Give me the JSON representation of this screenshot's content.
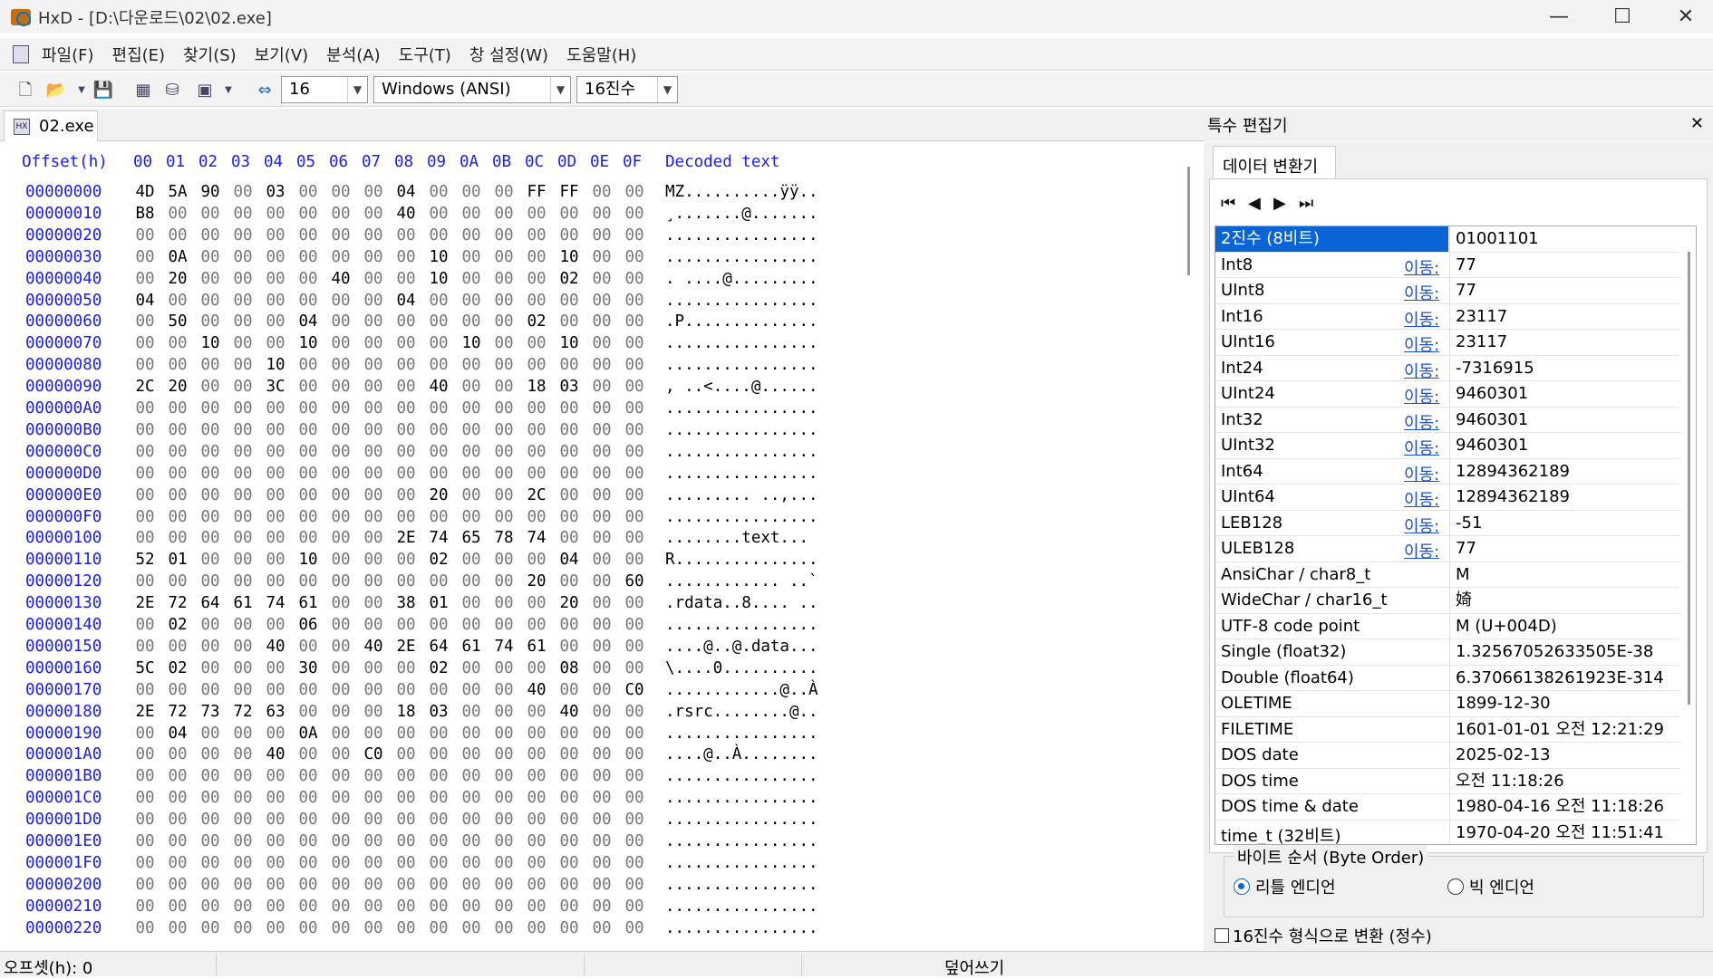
{
  "window": {
    "title": "HxD - [D:\\다운로드\\02\\02.exe]",
    "minimize": "—",
    "maximize": "☐",
    "close": "✕"
  },
  "menu": [
    "파일(F)",
    "편집(E)",
    "찾기(S)",
    "보기(V)",
    "분석(A)",
    "도구(T)",
    "창 설정(W)",
    "도움말(H)"
  ],
  "toolbar": {
    "bytes_per_row": "16",
    "charset": "Windows (ANSI)",
    "offset_base": "16진수"
  },
  "tab": {
    "label": "02.exe"
  },
  "hex": {
    "header_offset": "Offset(h)",
    "header_cols": [
      "00",
      "01",
      "02",
      "03",
      "04",
      "05",
      "06",
      "07",
      "08",
      "09",
      "0A",
      "0B",
      "0C",
      "0D",
      "0E",
      "0F"
    ],
    "header_decoded": "Decoded text",
    "rows": [
      {
        "off": "00000000",
        "bytes": "4D 5A 90 00 03 00 00 00 04 00 00 00 FF FF 00 00",
        "text": "MZ..........ÿÿ.."
      },
      {
        "off": "00000010",
        "bytes": "B8 00 00 00 00 00 00 00 40 00 00 00 00 00 00 00",
        "text": "¸.......@......."
      },
      {
        "off": "00000020",
        "bytes": "00 00 00 00 00 00 00 00 00 00 00 00 00 00 00 00",
        "text": "................"
      },
      {
        "off": "00000030",
        "bytes": "00 0A 00 00 00 00 00 00 00 10 00 00 00 10 00 00",
        "text": "................"
      },
      {
        "off": "00000040",
        "bytes": "00 20 00 00 00 00 40 00 00 10 00 00 00 02 00 00",
        "text": ". ....@........."
      },
      {
        "off": "00000050",
        "bytes": "04 00 00 00 00 00 00 00 04 00 00 00 00 00 00 00",
        "text": "................"
      },
      {
        "off": "00000060",
        "bytes": "00 50 00 00 00 04 00 00 00 00 00 00 02 00 00 00",
        "text": ".P.............."
      },
      {
        "off": "00000070",
        "bytes": "00 00 10 00 00 10 00 00 00 00 10 00 00 10 00 00",
        "text": "................"
      },
      {
        "off": "00000080",
        "bytes": "00 00 00 00 10 00 00 00 00 00 00 00 00 00 00 00",
        "text": "................"
      },
      {
        "off": "00000090",
        "bytes": "2C 20 00 00 3C 00 00 00 00 40 00 00 18 03 00 00",
        "text": ", ..<....@......"
      },
      {
        "off": "000000A0",
        "bytes": "00 00 00 00 00 00 00 00 00 00 00 00 00 00 00 00",
        "text": "................"
      },
      {
        "off": "000000B0",
        "bytes": "00 00 00 00 00 00 00 00 00 00 00 00 00 00 00 00",
        "text": "................"
      },
      {
        "off": "000000C0",
        "bytes": "00 00 00 00 00 00 00 00 00 00 00 00 00 00 00 00",
        "text": "................"
      },
      {
        "off": "000000D0",
        "bytes": "00 00 00 00 00 00 00 00 00 00 00 00 00 00 00 00",
        "text": "................"
      },
      {
        "off": "000000E0",
        "bytes": "00 00 00 00 00 00 00 00 00 20 00 00 2C 00 00 00",
        "text": "......... ..,..."
      },
      {
        "off": "000000F0",
        "bytes": "00 00 00 00 00 00 00 00 00 00 00 00 00 00 00 00",
        "text": "................"
      },
      {
        "off": "00000100",
        "bytes": "00 00 00 00 00 00 00 00 2E 74 65 78 74 00 00 00",
        "text": "........text..."
      },
      {
        "off": "00000110",
        "bytes": "52 01 00 00 00 10 00 00 00 02 00 00 00 04 00 00",
        "text": "R..............."
      },
      {
        "off": "00000120",
        "bytes": "00 00 00 00 00 00 00 00 00 00 00 00 20 00 00 60",
        "text": "............ ..`"
      },
      {
        "off": "00000130",
        "bytes": "2E 72 64 61 74 61 00 00 38 01 00 00 00 20 00 00",
        "text": ".rdata..8.... .."
      },
      {
        "off": "00000140",
        "bytes": "00 02 00 00 00 06 00 00 00 00 00 00 00 00 00 00",
        "text": "................"
      },
      {
        "off": "00000150",
        "bytes": "00 00 00 00 40 00 00 40 2E 64 61 74 61 00 00 00",
        "text": "....@..@.data..."
      },
      {
        "off": "00000160",
        "bytes": "5C 02 00 00 00 30 00 00 00 02 00 00 00 08 00 00",
        "text": "\\....0.........."
      },
      {
        "off": "00000170",
        "bytes": "00 00 00 00 00 00 00 00 00 00 00 00 40 00 00 C0",
        "text": "............@..À"
      },
      {
        "off": "00000180",
        "bytes": "2E 72 73 72 63 00 00 00 18 03 00 00 00 40 00 00",
        "text": ".rsrc........@.."
      },
      {
        "off": "00000190",
        "bytes": "00 04 00 00 00 0A 00 00 00 00 00 00 00 00 00 00",
        "text": "................"
      },
      {
        "off": "000001A0",
        "bytes": "00 00 00 00 40 00 00 C0 00 00 00 00 00 00 00 00",
        "text": "....@..À........"
      },
      {
        "off": "000001B0",
        "bytes": "00 00 00 00 00 00 00 00 00 00 00 00 00 00 00 00",
        "text": "................"
      },
      {
        "off": "000001C0",
        "bytes": "00 00 00 00 00 00 00 00 00 00 00 00 00 00 00 00",
        "text": "................"
      },
      {
        "off": "000001D0",
        "bytes": "00 00 00 00 00 00 00 00 00 00 00 00 00 00 00 00",
        "text": "................"
      },
      {
        "off": "000001E0",
        "bytes": "00 00 00 00 00 00 00 00 00 00 00 00 00 00 00 00",
        "text": "................"
      },
      {
        "off": "000001F0",
        "bytes": "00 00 00 00 00 00 00 00 00 00 00 00 00 00 00 00",
        "text": "................"
      },
      {
        "off": "00000200",
        "bytes": "00 00 00 00 00 00 00 00 00 00 00 00 00 00 00 00",
        "text": "................"
      },
      {
        "off": "00000210",
        "bytes": "00 00 00 00 00 00 00 00 00 00 00 00 00 00 00 00",
        "text": "................"
      },
      {
        "off": "00000220",
        "bytes": "00 00 00 00 00 00 00 00 00 00 00 00 00 00 00 00",
        "text": "................"
      }
    ]
  },
  "panel": {
    "title": "특수 편집기",
    "close": "✕",
    "tab": "데이터 변환기",
    "rows": [
      {
        "label": "2진수 (8비트)",
        "go": "",
        "value": "01001101"
      },
      {
        "label": "Int8",
        "go": "이동:",
        "value": "77"
      },
      {
        "label": "UInt8",
        "go": "이동:",
        "value": "77"
      },
      {
        "label": "Int16",
        "go": "이동:",
        "value": "23117"
      },
      {
        "label": "UInt16",
        "go": "이동:",
        "value": "23117"
      },
      {
        "label": "Int24",
        "go": "이동:",
        "value": "-7316915"
      },
      {
        "label": "UInt24",
        "go": "이동:",
        "value": "9460301"
      },
      {
        "label": "Int32",
        "go": "이동:",
        "value": "9460301"
      },
      {
        "label": "UInt32",
        "go": "이동:",
        "value": "9460301"
      },
      {
        "label": "Int64",
        "go": "이동:",
        "value": "12894362189"
      },
      {
        "label": "UInt64",
        "go": "이동:",
        "value": "12894362189"
      },
      {
        "label": "LEB128",
        "go": "이동:",
        "value": "-51"
      },
      {
        "label": "ULEB128",
        "go": "이동:",
        "value": "77"
      },
      {
        "label": "AnsiChar / char8_t",
        "go": "",
        "value": "M"
      },
      {
        "label": "WideChar / char16_t",
        "go": "",
        "value": "婍"
      },
      {
        "label": "UTF-8 code point",
        "go": "",
        "value": "M (U+004D)"
      },
      {
        "label": "Single (float32)",
        "go": "",
        "value": "1.32567052633505E-38"
      },
      {
        "label": "Double (float64)",
        "go": "",
        "value": "6.37066138261923E-314"
      },
      {
        "label": "OLETIME",
        "go": "",
        "value": "1899-12-30"
      },
      {
        "label": "FILETIME",
        "go": "",
        "value": "1601-01-01 오전 12:21:29"
      },
      {
        "label": "DOS date",
        "go": "",
        "value": "2025-02-13"
      },
      {
        "label": "DOS time",
        "go": "",
        "value": "오전 11:18:26"
      },
      {
        "label": "DOS time & date",
        "go": "",
        "value": "1980-04-16 오전 11:18:26"
      },
      {
        "label": "time_t (32비트)",
        "go": "",
        "value": "1970-04-20 오전 11:51:41"
      }
    ],
    "byte_order_legend": "바이트 순서 (Byte Order)",
    "little_endian": "리틀 엔디언",
    "big_endian": "빅 엔디언",
    "hex_checkbox": "16진수 형식으로 변환 (정수)"
  },
  "status": {
    "offset": "오프셋(h): 0",
    "mode": "덮어쓰기"
  }
}
